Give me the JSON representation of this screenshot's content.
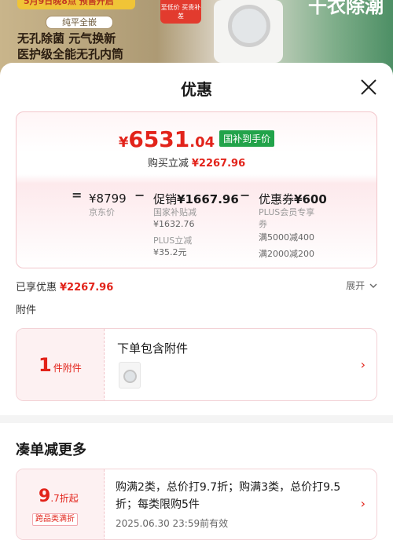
{
  "background": {
    "strip_text": "5月9日晚8点 预售开启",
    "sticker_text": "至低价 买贵补差",
    "tag": "纯平全嵌",
    "line1": "无孔除菌 元气换新",
    "line2": "医护级全能无孔内筒",
    "right_text": "干衣除潮"
  },
  "sheet": {
    "title": "优惠",
    "close_icon": "close-icon"
  },
  "price_card": {
    "currency": "¥",
    "final_int": "6531",
    "final_dec": ".04",
    "final_tag": "国补到手价",
    "saving_label": "购买立减",
    "saving_amount": "¥2267.96",
    "eq": "=",
    "jd_price": "¥8799",
    "jd_label": "京东价",
    "minus1": "−",
    "promo_label": "促销",
    "promo_amount": "¥1667.96",
    "promo_sub1_label": "国家补贴减",
    "promo_sub1_amount": "¥1632.76",
    "promo_sub2_label": "PLUS立减",
    "promo_sub2_amount": "¥35.2元",
    "minus2": "−",
    "coupon_label": "优惠券",
    "coupon_amount": "¥600",
    "coupon_sub1": "PLUS会员专享",
    "coupon_sub1b": "券",
    "coupon_sub2": "满5000减400",
    "coupon_sub3": "满2000减200"
  },
  "enjoy": {
    "label": "已享优惠",
    "amount": "¥2267.96",
    "expand": "展开",
    "expand_icon": "chevron-down-icon"
  },
  "accessory": {
    "section_label": "附件",
    "count": "1",
    "unit": "件附件",
    "title": "下单包含附件",
    "thumb_icon": "washer-thumbnail",
    "chevron_icon": "chevron-right-icon"
  },
  "more": {
    "title": "凑单减更多",
    "discount_num": "9",
    "discount_dec": ".7",
    "discount_unit": "折起",
    "type": "跨品类满折",
    "text": "购满2类，总价打9.7折；购满3类，总价打9.5折；每类限购5件",
    "valid": "2025.06.30 23:59前有效"
  },
  "colors": {
    "accent": "#e2231a",
    "tag_green": "#22a34a",
    "card_border": "#f2c6cb"
  }
}
